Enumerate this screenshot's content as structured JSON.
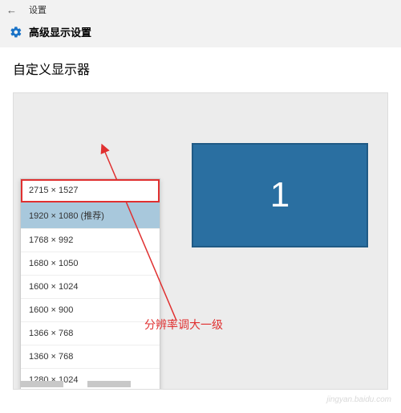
{
  "titlebar": {
    "label": "设置"
  },
  "header": {
    "title": "高级显示设置"
  },
  "section": {
    "title": "自定义显示器"
  },
  "monitor": {
    "number": "1"
  },
  "resolutions": {
    "items": [
      {
        "label": "2715 × 1527",
        "highlighted": true
      },
      {
        "label": "1920 × 1080 (推荐)",
        "selected": true
      },
      {
        "label": "1768 × 992"
      },
      {
        "label": "1680 × 1050"
      },
      {
        "label": "1600 × 1024"
      },
      {
        "label": "1600 × 900"
      },
      {
        "label": "1366 × 768"
      },
      {
        "label": "1360 × 768"
      },
      {
        "label": "1280 × 1024"
      }
    ]
  },
  "annotation": {
    "text": "分辨率调大一级"
  },
  "watermark": {
    "text": "jingyan.baidu.com"
  }
}
